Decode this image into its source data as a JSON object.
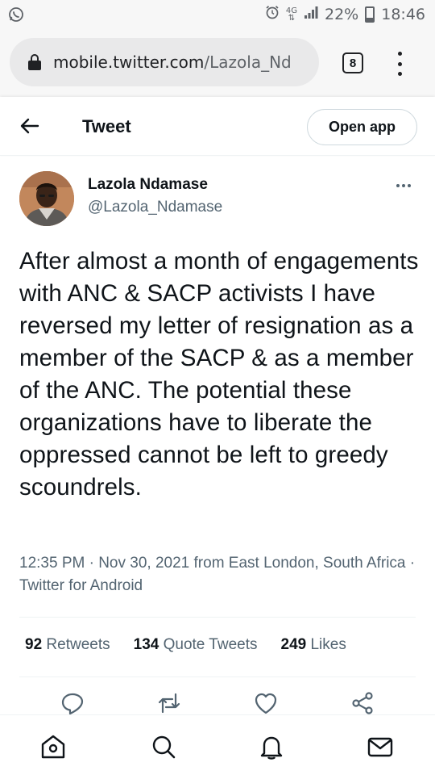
{
  "status_bar": {
    "network": "4G",
    "battery": "22%",
    "time": "18:46",
    "icons": [
      "whatsapp-icon",
      "alarm-icon",
      "network-4g-icon",
      "signal-icon",
      "battery-icon"
    ]
  },
  "browser": {
    "url_main": "mobile.twitter.com",
    "url_path": "/Lazola_Nd",
    "tab_count": "8",
    "icons": [
      "lock-icon",
      "tab-switcher-icon",
      "more-vert-icon"
    ]
  },
  "header": {
    "title": "Tweet",
    "open_app": "Open app"
  },
  "tweet": {
    "author_name": "Lazola Ndamase",
    "author_handle": "@Lazola_Ndamase",
    "text": "After almost a month of engagements with ANC & SACP activists I have reversed my letter of resignation as a member of the SACP & as a member of the ANC. The potential these organizations have to liberate the oppressed cannot be left to greedy scoundrels.",
    "meta": "12:35 PM · Nov 30, 2021 from East London, South Africa · Twitter for Android",
    "stats": {
      "retweets_count": "92",
      "retweets_label": "Retweets",
      "quotes_count": "134",
      "quotes_label": "Quote Tweets",
      "likes_count": "249",
      "likes_label": "Likes"
    }
  },
  "actions": [
    "reply-icon",
    "retweet-icon",
    "like-icon",
    "share-icon"
  ],
  "bottom_nav": [
    "home-icon",
    "search-icon",
    "notifications-icon",
    "messages-icon"
  ],
  "colors": {
    "text": "#0f1419",
    "secondary": "#536471",
    "divider": "#eff3f4",
    "chrome_bg": "#f7f7f7",
    "url_pill": "#e9e9ea"
  }
}
